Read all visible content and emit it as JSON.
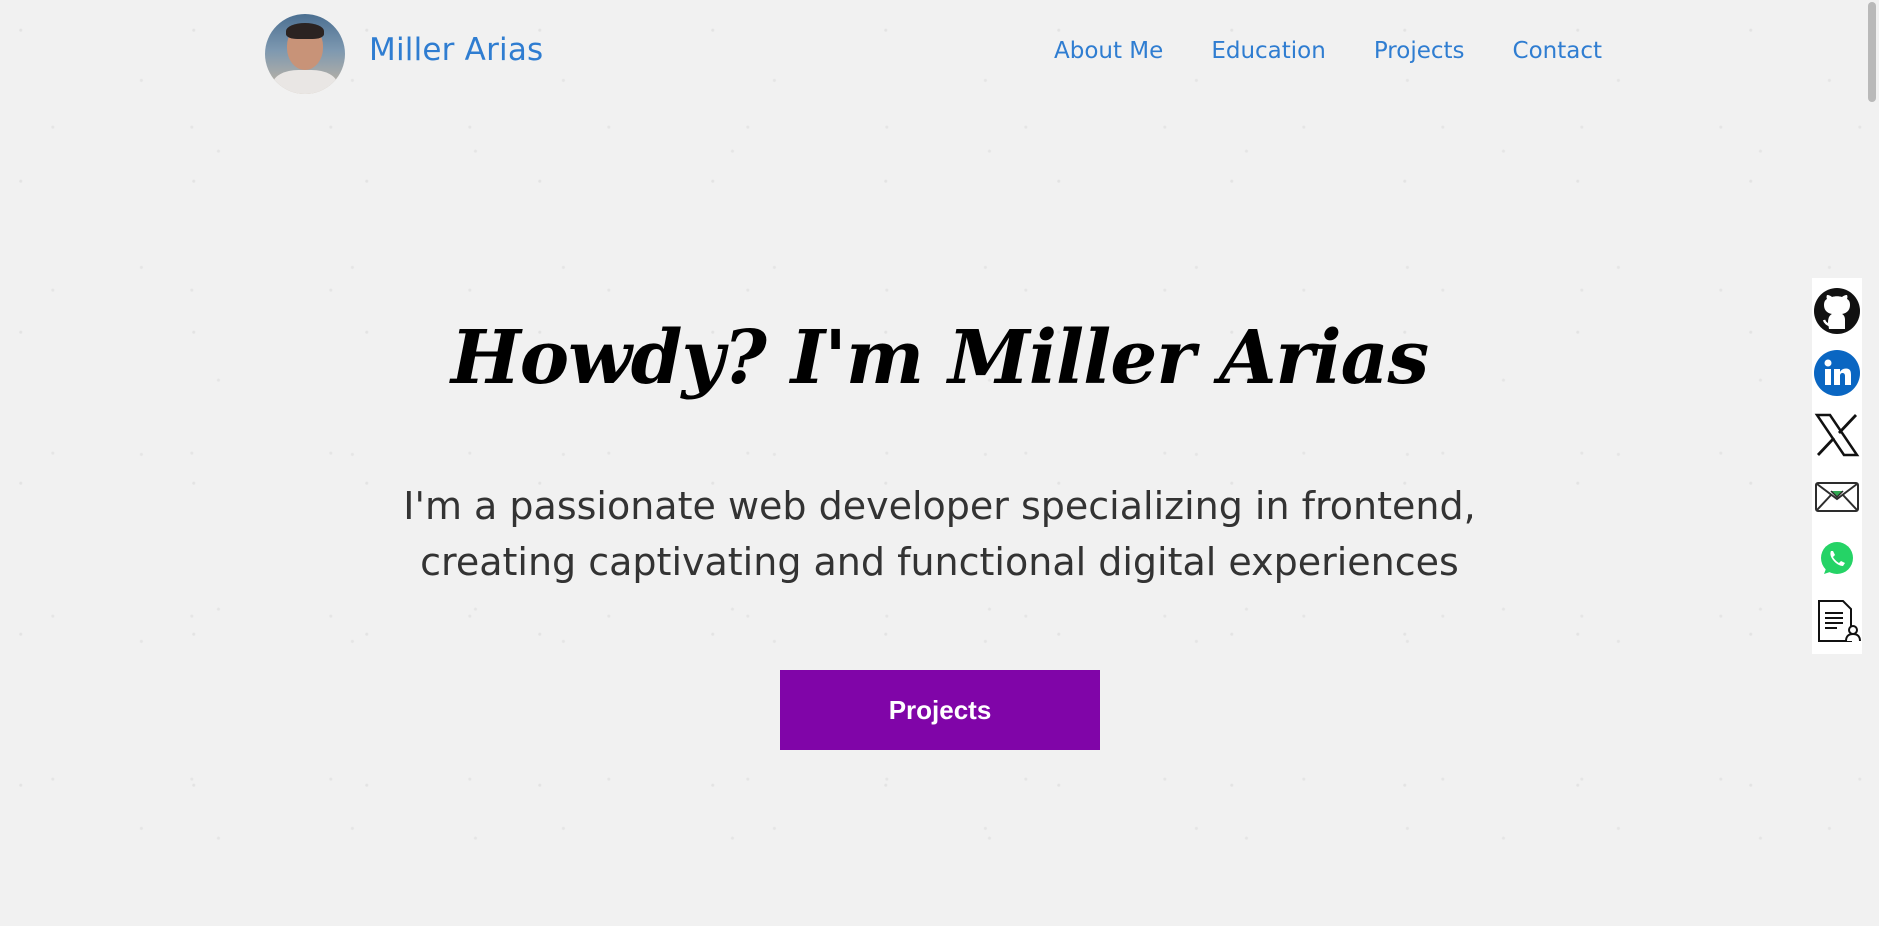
{
  "header": {
    "brand_name": "Miller Arias",
    "nav": [
      {
        "label": "About Me"
      },
      {
        "label": "Education"
      },
      {
        "label": "Projects"
      },
      {
        "label": "Contact"
      }
    ]
  },
  "hero": {
    "title": "Howdy? I'm Miller Arias",
    "subtitle": "I'm a passionate web developer specializing in frontend, creating captivating and functional digital experiences",
    "cta_label": "Projects"
  },
  "social_links": [
    {
      "icon": "github-icon"
    },
    {
      "icon": "linkedin-icon"
    },
    {
      "icon": "x-twitter-icon"
    },
    {
      "icon": "email-icon"
    },
    {
      "icon": "whatsapp-icon"
    },
    {
      "icon": "resume-icon"
    }
  ],
  "colors": {
    "link": "#2f7dd1",
    "button": "#8005a8",
    "background": "#f1f1f1"
  }
}
